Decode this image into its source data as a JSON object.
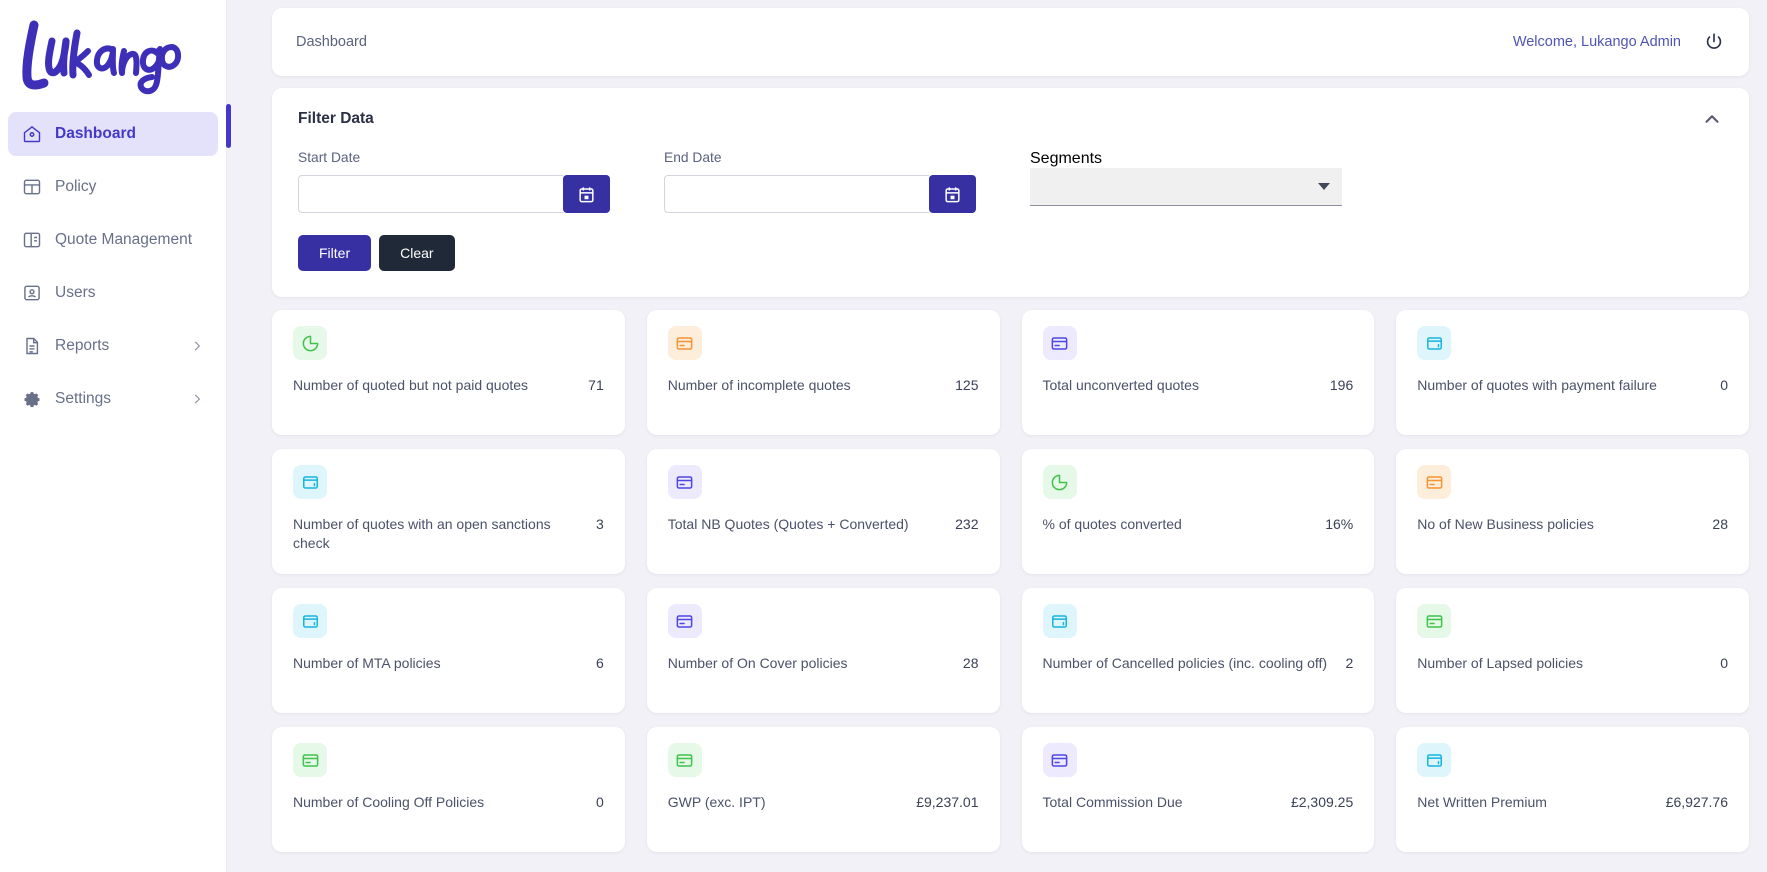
{
  "brand": {
    "name": "Lukango"
  },
  "sidebar": {
    "items": [
      {
        "label": "Dashboard",
        "icon": "home-icon",
        "active": true,
        "chevron": false
      },
      {
        "label": "Policy",
        "icon": "layout-icon",
        "active": false,
        "chevron": false
      },
      {
        "label": "Quote Management",
        "icon": "panel-icon",
        "active": false,
        "chevron": true
      },
      {
        "label": "Users",
        "icon": "user-icon",
        "active": false,
        "chevron": false
      },
      {
        "label": "Reports",
        "icon": "document-icon",
        "active": false,
        "chevron": true
      },
      {
        "label": "Settings",
        "icon": "gear-icon",
        "active": false,
        "chevron": true
      }
    ]
  },
  "topbar": {
    "breadcrumb": "Dashboard",
    "welcome": "Welcome, Lukango Admin",
    "logout_icon": "power-icon"
  },
  "filter": {
    "title": "Filter Data",
    "collapse_icon": "chevron-up-icon",
    "start_date": {
      "label": "Start Date",
      "value": "",
      "placeholder": ""
    },
    "end_date": {
      "label": "End Date",
      "value": "",
      "placeholder": ""
    },
    "segments": {
      "label": "Segments",
      "value": ""
    },
    "filter_button": "Filter",
    "clear_button": "Clear"
  },
  "colors": {
    "primary": "#3730a3",
    "accent": "#4338ca",
    "dark": "#1f2937",
    "green": "#3fc34b",
    "orange": "#f59433",
    "indigo": "#4f46e5",
    "cyan": "#16b5e0",
    "page_bg": "#f1f1f7"
  },
  "kpis": [
    {
      "title": "Number of quoted but not paid quotes",
      "value": "71",
      "icon": "pie-chart-icon",
      "tint": "t-green",
      "stroke": "#3fc34b"
    },
    {
      "title": "Number of incomplete quotes",
      "value": "125",
      "icon": "credit-card-icon",
      "tint": "t-orange",
      "stroke": "#f59433"
    },
    {
      "title": "Total unconverted quotes",
      "value": "196",
      "icon": "credit-card-icon",
      "tint": "t-indigo",
      "stroke": "#4f46e5"
    },
    {
      "title": "Number of quotes with payment failure",
      "value": "0",
      "icon": "wallet-icon",
      "tint": "t-cyan",
      "stroke": "#16b5e0"
    },
    {
      "title": "Number of quotes with an open sanctions check",
      "value": "3",
      "icon": "wallet-icon",
      "tint": "t-cyan",
      "stroke": "#16b5e0"
    },
    {
      "title": "Total NB Quotes (Quotes + Converted)",
      "value": "232",
      "icon": "credit-card-icon",
      "tint": "t-indigo",
      "stroke": "#4f46e5"
    },
    {
      "title": "% of quotes converted",
      "value": "16%",
      "icon": "pie-chart-icon",
      "tint": "t-green",
      "stroke": "#3fc34b"
    },
    {
      "title": "No of New Business policies",
      "value": "28",
      "icon": "credit-card-icon",
      "tint": "t-orange",
      "stroke": "#f59433"
    },
    {
      "title": "Number of MTA policies",
      "value": "6",
      "icon": "wallet-icon",
      "tint": "t-cyan",
      "stroke": "#16b5e0"
    },
    {
      "title": "Number of On Cover policies",
      "value": "28",
      "icon": "credit-card-icon",
      "tint": "t-indigo",
      "stroke": "#4f46e5"
    },
    {
      "title": "Number of Cancelled policies (inc. cooling off)",
      "value": "2",
      "icon": "wallet-icon",
      "tint": "t-cyan",
      "stroke": "#16b5e0"
    },
    {
      "title": "Number of Lapsed policies",
      "value": "0",
      "icon": "credit-card-icon",
      "tint": "t-green",
      "stroke": "#3fc34b"
    },
    {
      "title": "Number of Cooling Off Policies",
      "value": "0",
      "icon": "credit-card-icon",
      "tint": "t-green",
      "stroke": "#3fc34b"
    },
    {
      "title": "GWP (exc. IPT)",
      "value": "£9,237.01",
      "icon": "credit-card-icon",
      "tint": "t-green",
      "stroke": "#3fc34b"
    },
    {
      "title": "Total Commission Due",
      "value": "£2,309.25",
      "icon": "credit-card-icon",
      "tint": "t-indigo",
      "stroke": "#4f46e5"
    },
    {
      "title": "Net Written Premium",
      "value": "£6,927.76",
      "icon": "wallet-icon",
      "tint": "t-cyan",
      "stroke": "#16b5e0"
    }
  ]
}
